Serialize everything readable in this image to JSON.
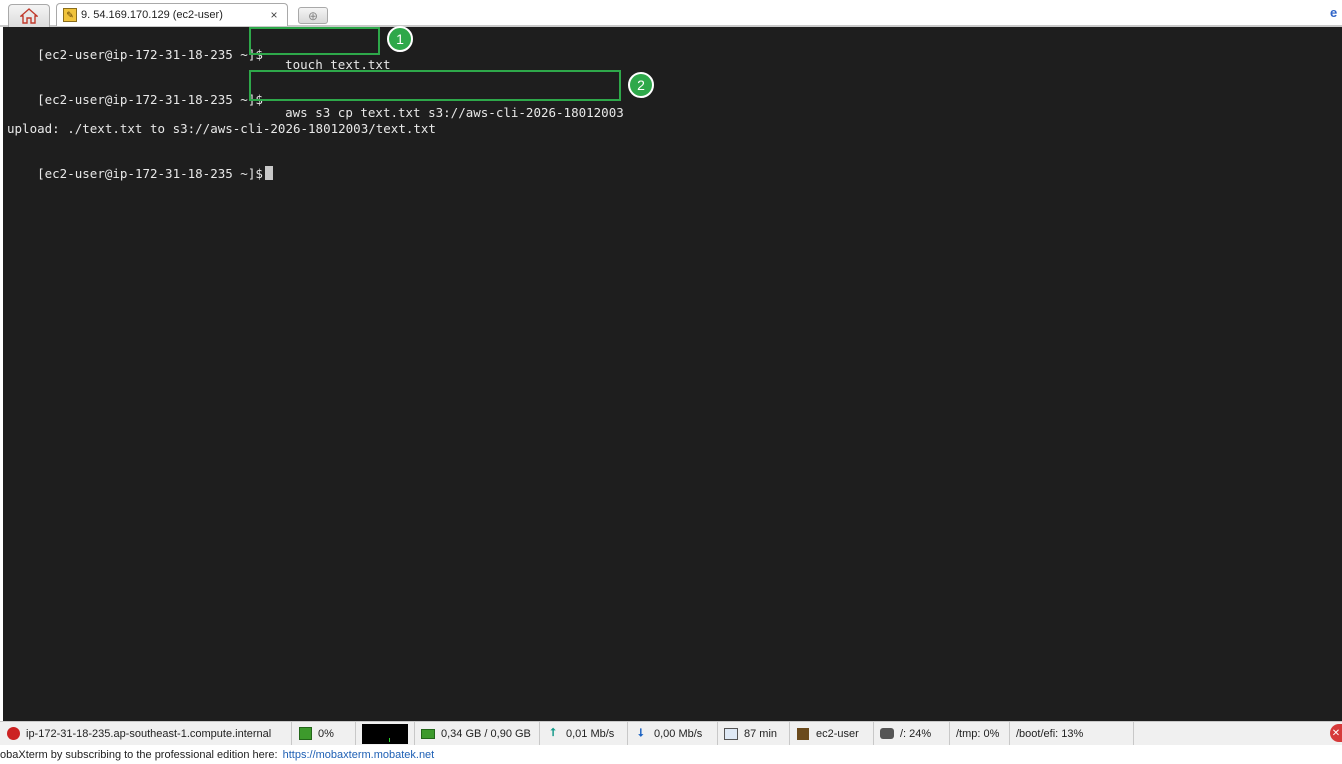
{
  "tabs": {
    "home_icon": "home-icon",
    "session_title": "9. 54.169.170.129 (ec2-user)",
    "session_close": "×",
    "new_tab_symbol": "⊕"
  },
  "terminal": {
    "prompt": "[ec2-user@ip-172-31-18-235 ~]$",
    "cmd1": "touch text.txt",
    "cmd2": "aws s3 cp text.txt s3://aws-cli-2026-18012003",
    "output": "upload: ./text.txt to s3://aws-cli-2026-18012003/text.txt",
    "badge1": "1",
    "badge2": "2",
    "highlight_color": "#2ea84a",
    "background_color": "#1e1e1e"
  },
  "statusbar": {
    "hostname": "ip-172-31-18-235.ap-southeast-1.compute.internal",
    "cpu": "0%",
    "memory": "0,34 GB / 0,90 GB",
    "upload": "0,01 Mb/s",
    "download": "0,00 Mb/s",
    "uptime": "87 min",
    "user": "ec2-user",
    "disk_root": "/: 24%",
    "disk_tmp": "/tmp: 0%",
    "disk_boot": "/boot/efi: 13%"
  },
  "promo": {
    "text": "obaXterm by subscribing to the professional edition here:",
    "link": "https://mobaxterm.mobatek.net"
  }
}
